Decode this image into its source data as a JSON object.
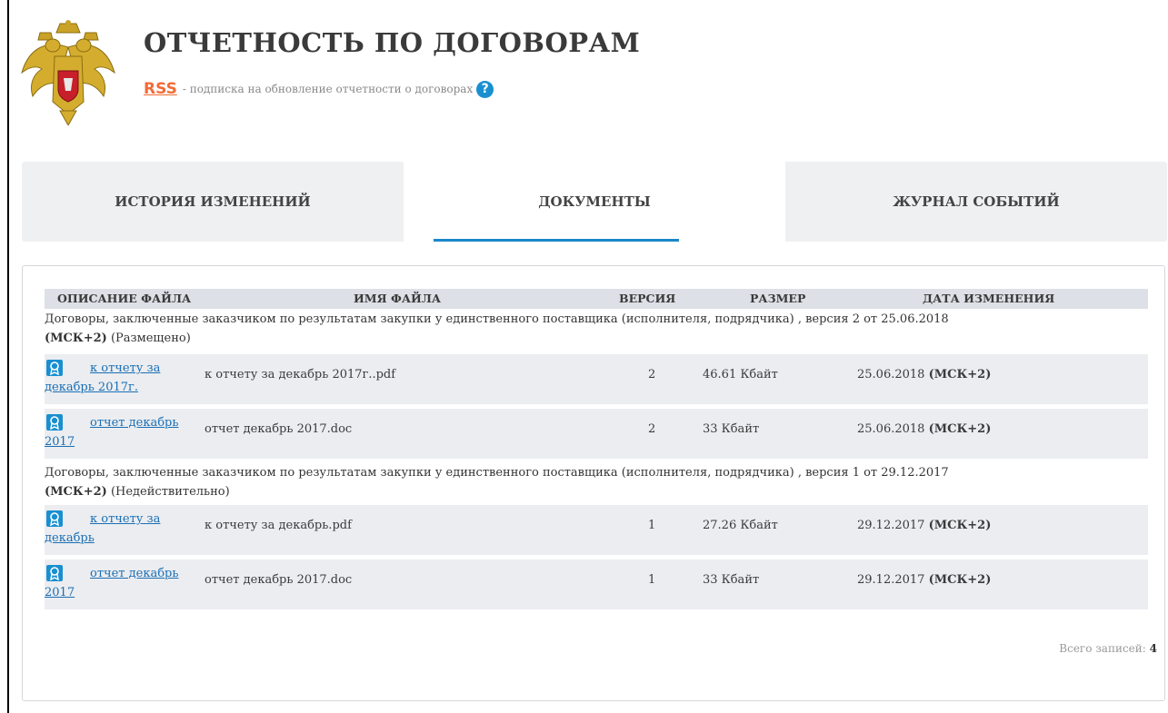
{
  "header": {
    "title": "ОТЧЕТНОСТЬ ПО ДОГОВОРАМ",
    "rss_label": "RSS",
    "rss_description": "- подписка на обновление отчетности о договорах",
    "help_icon": "question-circle-icon",
    "emblem_icon": "russian-coat-of-arms-icon"
  },
  "tabs": [
    {
      "label": "ИСТОРИЯ ИЗМЕНЕНИЙ",
      "active": false
    },
    {
      "label": "ДОКУМЕНТЫ",
      "active": true
    },
    {
      "label": "ЖУРНАЛ СОБЫТИЙ",
      "active": false
    }
  ],
  "table": {
    "columns": [
      "ОПИСАНИЕ ФАЙЛА",
      "ИМЯ ФАЙЛА",
      "ВЕРСИЯ",
      "РАЗМЕР",
      "ДАТА ИЗМЕНЕНИЯ"
    ],
    "groups": [
      {
        "text": "Договоры, заключенные заказчиком по результатам закупки у единственного поставщика (исполнителя, подрядчика) , версия 2 от 25.06.2018",
        "tz": "(МСК+2)",
        "status": "(Размещено)",
        "rows": [
          {
            "description": "к отчету за декабрь 2017г.",
            "filename": "к отчету за декабрь 2017г..pdf",
            "version": "2",
            "size": "46.61 Кбайт",
            "date": "25.06.2018",
            "tz": "(МСК+2)"
          },
          {
            "description": "отчет декабрь 2017",
            "filename": "отчет декабрь 2017.doc",
            "version": "2",
            "size": "33 Кбайт",
            "date": "25.06.2018",
            "tz": "(МСК+2)"
          }
        ]
      },
      {
        "text": "Договоры, заключенные заказчиком по результатам закупки у единственного поставщика (исполнителя, подрядчика) , версия 1 от 29.12.2017",
        "tz": "(МСК+2)",
        "status": "(Недействительно)",
        "rows": [
          {
            "description": "к отчету за декабрь",
            "filename": "к отчету за декабрь.pdf",
            "version": "1",
            "size": "27.26 Кбайт",
            "date": "29.12.2017",
            "tz": "(МСК+2)"
          },
          {
            "description": "отчет декабрь 2017",
            "filename": "отчет декабрь 2017.doc",
            "version": "1",
            "size": "33 Кбайт",
            "date": "29.12.2017",
            "tz": "(МСК+2)"
          }
        ]
      }
    ]
  },
  "footer": {
    "total_label": "Всего записей:",
    "total_value": "4"
  },
  "colors": {
    "accent": "#1a87c9",
    "rss": "#f26b36",
    "link": "#1a6fb5"
  }
}
